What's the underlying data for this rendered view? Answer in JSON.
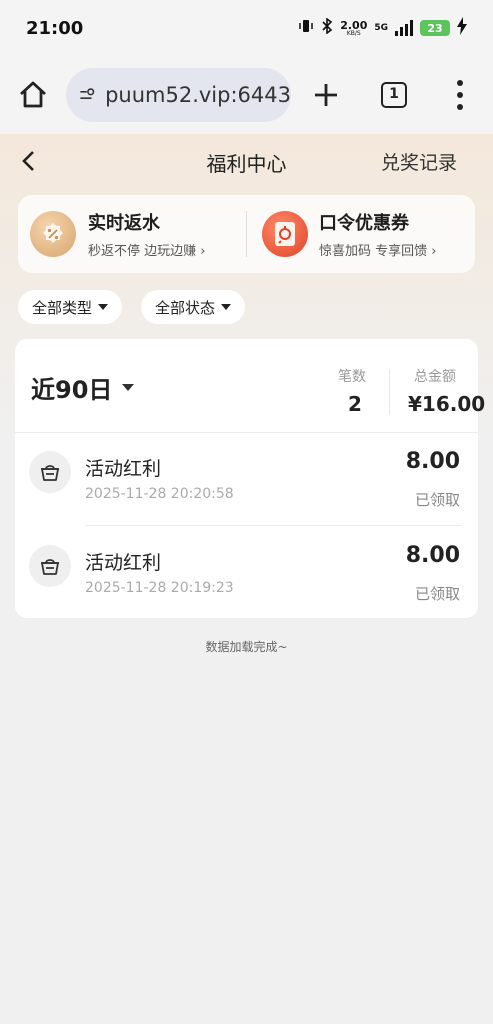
{
  "status_bar": {
    "time": "21:00",
    "net_speed_value": "2.00",
    "net_speed_unit": "KB/S",
    "network": "5G",
    "battery": "23"
  },
  "browser": {
    "url": "puum52.vip:6443",
    "tab_count": "1"
  },
  "header": {
    "title": "福利中心",
    "records_link": "兑奖记录"
  },
  "promos": [
    {
      "title": "实时返水",
      "subtitle": "秒返不停 边玩边赚 ›",
      "icon": "rebate-icon"
    },
    {
      "title": "口令优惠券",
      "subtitle": "惊喜加码 专享回馈 ›",
      "icon": "coupon-icon"
    }
  ],
  "filters": {
    "type": "全部类型",
    "status": "全部状态"
  },
  "summary": {
    "period": "近90日",
    "count_label": "笔数",
    "count_value": "2",
    "total_label": "总金额",
    "total_value": "¥16.00"
  },
  "records": [
    {
      "title": "活动红利",
      "time": "2025-11-28 20:20:58",
      "amount": "8.00",
      "status": "已领取",
      "icon": "gift-basket-icon"
    },
    {
      "title": "活动红利",
      "time": "2025-11-28 20:19:23",
      "amount": "8.00",
      "status": "已领取",
      "icon": "gift-basket-icon"
    }
  ],
  "load_status": "数据加载完成~",
  "colors": {
    "accent_rebate": "#d8a46c",
    "accent_coupon": "#e04226",
    "battery": "#5cc45c"
  }
}
